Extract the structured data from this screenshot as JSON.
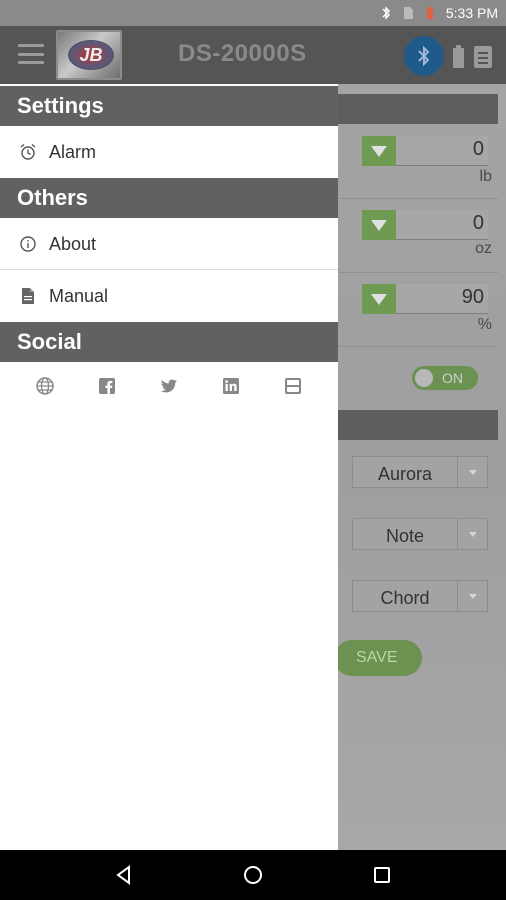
{
  "status_bar": {
    "time": "5:33 PM"
  },
  "header": {
    "title": "DS-20000S",
    "logo_text": "JB"
  },
  "drawer": {
    "sections": [
      {
        "title": "Settings"
      },
      {
        "title": "Others"
      },
      {
        "title": "Social"
      }
    ],
    "items": {
      "alarm": "Alarm",
      "about": "About",
      "manual": "Manual"
    },
    "social_icons": [
      "globe-icon",
      "facebook-icon",
      "twitter-icon",
      "linkedin-icon",
      "youtube-icon"
    ]
  },
  "background": {
    "fields": [
      {
        "value": "0",
        "unit": "lb"
      },
      {
        "value": "0",
        "unit": "oz"
      },
      {
        "value": "90",
        "unit": "%"
      }
    ],
    "toggle_label": "ON",
    "selects": [
      "Aurora",
      "Note",
      "Chord"
    ],
    "save_label": "SAVE"
  },
  "colors": {
    "drawer_header": "#616161",
    "app_bar": "#555555",
    "accent_green": "#6c9252",
    "bluetooth": "#1f5a8a"
  }
}
